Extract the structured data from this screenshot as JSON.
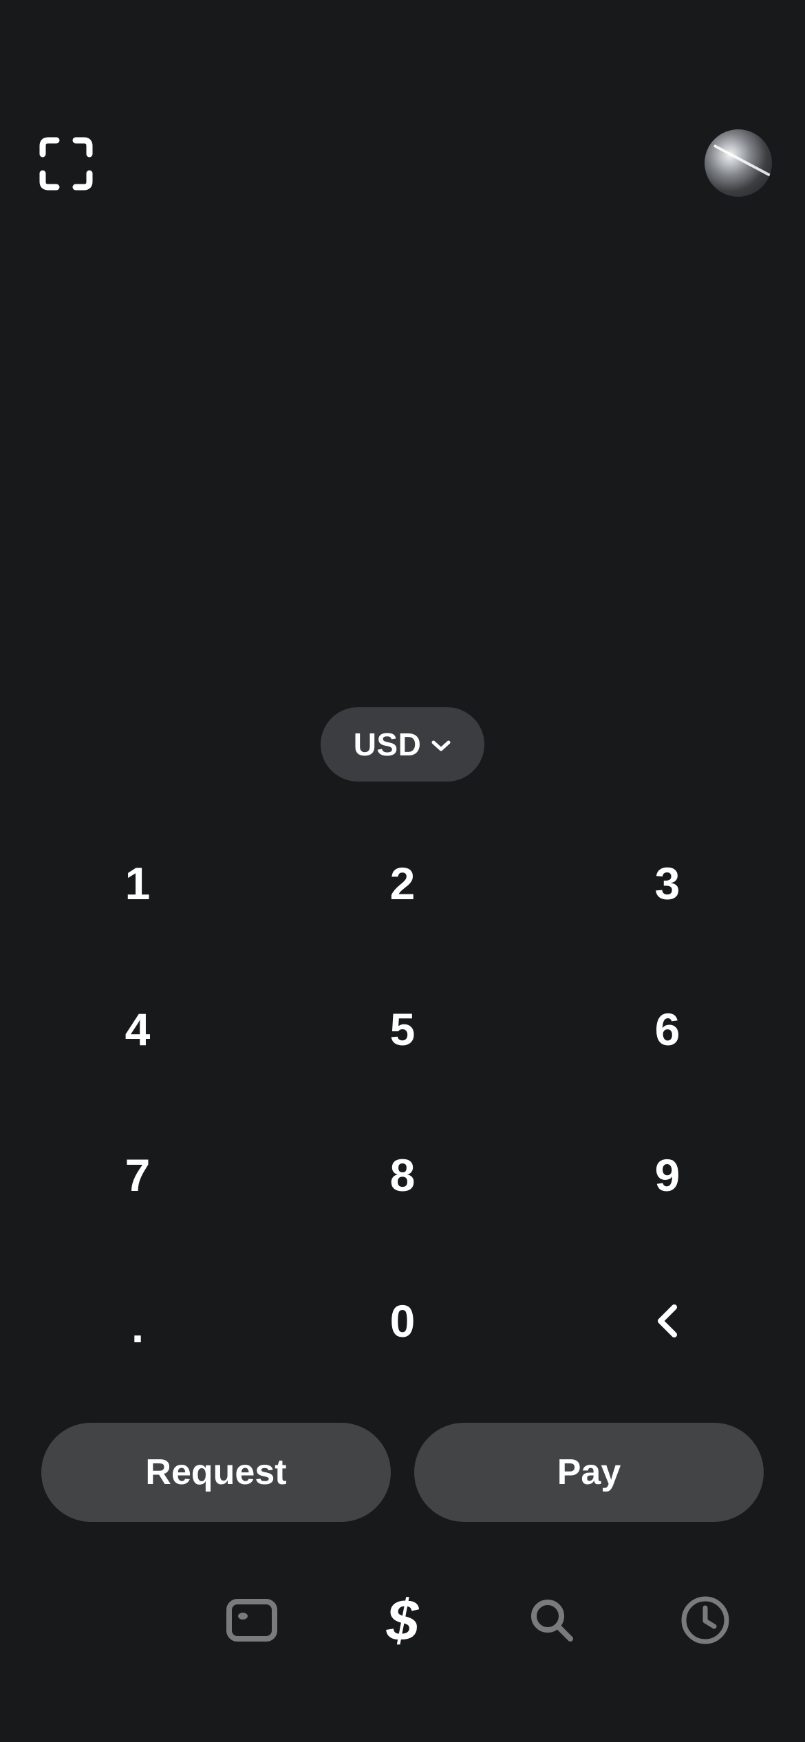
{
  "header": {
    "scan_icon": "qr-scan-icon",
    "avatar": "profile-avatar"
  },
  "currency": {
    "label": "USD",
    "icon": "chevron-down-icon"
  },
  "keypad": {
    "keys": [
      "1",
      "2",
      "3",
      "4",
      "5",
      "6",
      "7",
      "8",
      "9",
      ".",
      "0"
    ],
    "backspace_icon": "chevron-left-icon"
  },
  "actions": {
    "request_label": "Request",
    "pay_label": "Pay"
  },
  "tabbar": {
    "tabs": [
      {
        "icon": "card-icon",
        "active": false
      },
      {
        "icon": "dollar-icon",
        "symbol": "$",
        "active": true
      },
      {
        "icon": "search-icon",
        "active": false
      },
      {
        "icon": "clock-icon",
        "active": false
      }
    ]
  },
  "colors": {
    "background": "#18191b",
    "pill": "#3c3d40",
    "button": "#434446",
    "text": "#ffffff",
    "inactive_icon": "#7a7b7d"
  }
}
